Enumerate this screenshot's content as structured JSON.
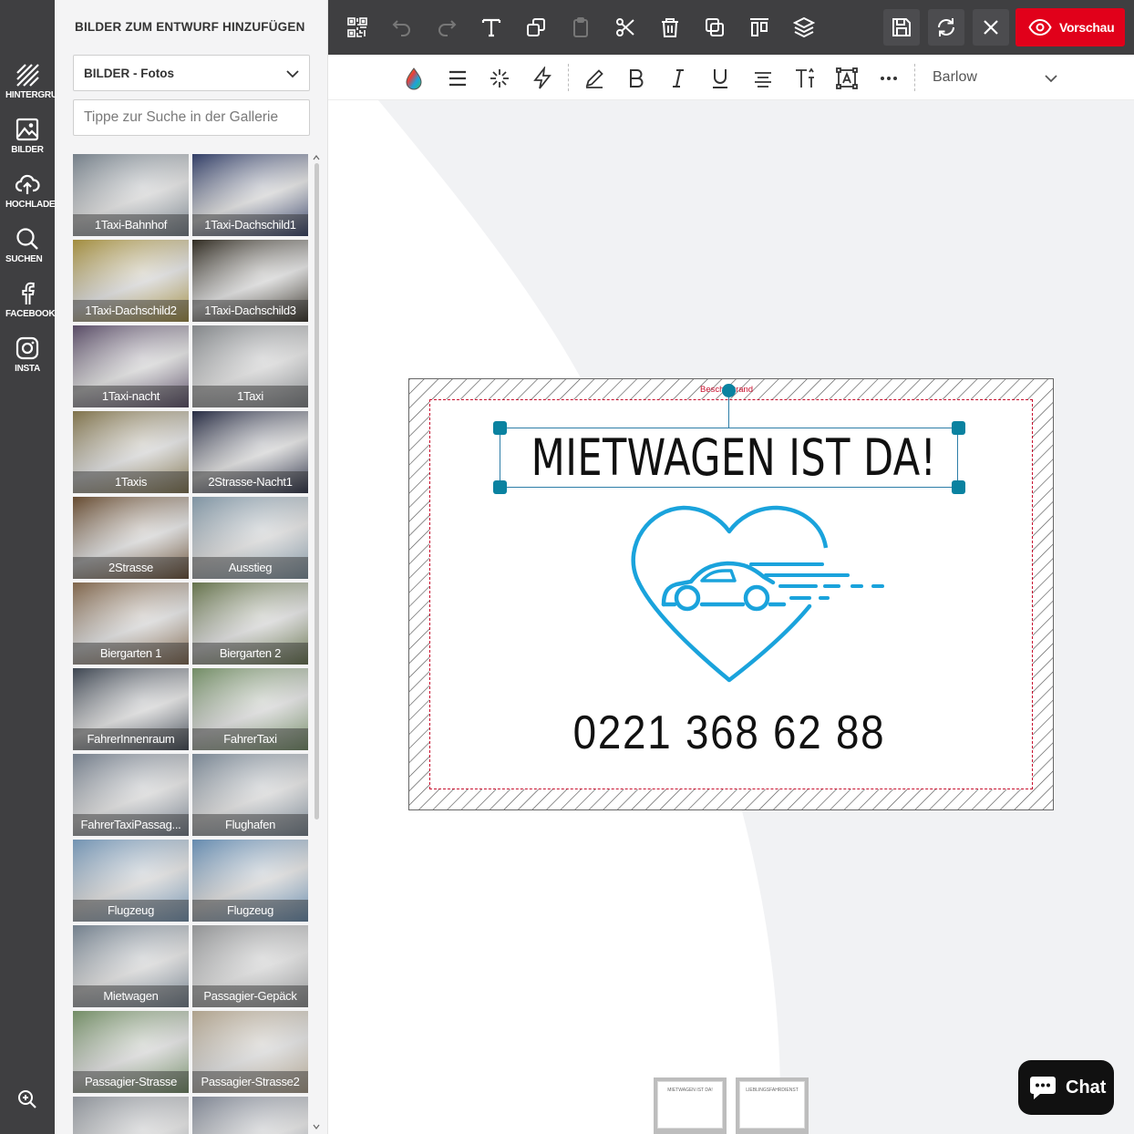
{
  "rail": {
    "items": [
      {
        "label": "HINTERGRUND",
        "icon": "background-hatch-icon"
      },
      {
        "label": "BILDER",
        "icon": "image-icon"
      },
      {
        "label": "HOCHLADEN",
        "icon": "cloud-upload-icon"
      },
      {
        "label": "SUCHEN",
        "icon": "search-icon"
      },
      {
        "label": "FACEBOOK",
        "icon": "facebook-icon"
      },
      {
        "label": "INSTA",
        "icon": "instagram-icon"
      }
    ]
  },
  "panel": {
    "title": "BILDER ZUM ENTWURF HINZUFÜGEN",
    "select_value": "BILDER - Fotos",
    "search_placeholder": "Tippe zur Suche in der Gallerie"
  },
  "gallery": [
    {
      "label": "1Taxi-Bahnhof",
      "color": "#7d8a96"
    },
    {
      "label": "1Taxi-Dachschild1",
      "color": "#2b3a6b"
    },
    {
      "label": "1Taxi-Dachschild2",
      "color": "#b49a3a"
    },
    {
      "label": "1Taxi-Dachschild3",
      "color": "#2a2418"
    },
    {
      "label": "1Taxi-nacht",
      "color": "#5a4a6a"
    },
    {
      "label": "1Taxi",
      "color": "#8e9296"
    },
    {
      "label": "1Taxis",
      "color": "#8a7a4a"
    },
    {
      "label": "2Strasse-Nacht1",
      "color": "#1e2440"
    },
    {
      "label": "2Strasse",
      "color": "#6b4a2a"
    },
    {
      "label": "Ausstieg",
      "color": "#8aa3b5"
    },
    {
      "label": "Biergarten 1",
      "color": "#8a6a4a"
    },
    {
      "label": "Biergarten 2",
      "color": "#6a7a4a"
    },
    {
      "label": "FahrerInnenraum",
      "color": "#3a4452"
    },
    {
      "label": "FahrerTaxi",
      "color": "#7a9a6a"
    },
    {
      "label": "FahrerTaxiPassag...",
      "color": "#7a8696"
    },
    {
      "label": "Flughafen",
      "color": "#8090a0"
    },
    {
      "label": "Flugzeug",
      "color": "#7aa2c8"
    },
    {
      "label": "Flugzeug",
      "color": "#6a98c4"
    },
    {
      "label": "Mietwagen",
      "color": "#7a8a9a"
    },
    {
      "label": "Passagier-Gepäck",
      "color": "#a0a2a4"
    },
    {
      "label": "Passagier-Strasse",
      "color": "#7a9a6a"
    },
    {
      "label": "Passagier-Strasse2",
      "color": "#c4b49a"
    },
    {
      "label": "",
      "color": "#9aa0a8"
    },
    {
      "label": "",
      "color": "#8890a0"
    }
  ],
  "toolbar": {
    "top_icons": [
      "qr-code-icon",
      "undo-icon",
      "redo-icon",
      "text-icon",
      "copy-icon",
      "paste-icon",
      "cut-icon",
      "delete-icon",
      "duplicate-icon",
      "align-icon",
      "layers-icon"
    ],
    "save_icon": "save-icon",
    "sync_icon": "sync-icon",
    "close_icon": "close-icon",
    "preview_label": "Vorschau"
  },
  "format": {
    "icons": [
      "color-drop-icon",
      "line-height-icon",
      "effects-icon",
      "flash-icon",
      "pencil-icon",
      "bold-icon",
      "italic-icon",
      "underline-icon",
      "text-align-icon",
      "text-size-icon",
      "text-box-icon",
      "more-icon"
    ],
    "font": "Barlow"
  },
  "canvas": {
    "bleed_label": "Beschnittrand",
    "headline": "MIETWAGEN IST DA!",
    "phone": "0221 368 62 88",
    "accent": "#1aa3dc",
    "bleed_color": "#c8102e"
  },
  "pages": [
    {
      "preview": "MIETWAGEN IST DA!"
    },
    {
      "preview": "LIEBLINGSFAHRDIENST"
    }
  ],
  "chat": {
    "label": "Chat"
  }
}
